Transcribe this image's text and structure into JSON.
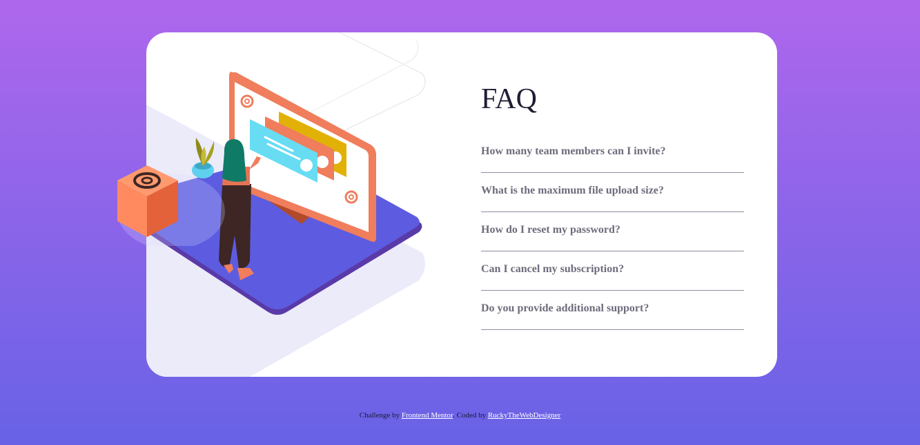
{
  "colors": {
    "background_top": "#ae67ec",
    "background_bottom": "#6862e6",
    "card": "#ffffff",
    "heading": "#1f1c34",
    "question": "#6d6c7c",
    "divider": "#8e8ca0",
    "link": "#ffffff"
  },
  "faq": {
    "title": "FAQ",
    "questions": [
      "How many team members can I invite?",
      "What is the maximum file upload size?",
      "How do I reset my password?",
      "Can I cancel my subscription?",
      "Do you provide additional support?"
    ]
  },
  "attribution": {
    "prefix": "Challenge by ",
    "challenge_link": "Frontend Mentor",
    "middle": ". Coded by ",
    "author_link": "RuckyTheWebDesigner"
  },
  "illustration": {
    "icons": [
      "at-sign-icon",
      "plant-icon",
      "monitor-icon",
      "woman-figure",
      "cube-icon"
    ]
  }
}
